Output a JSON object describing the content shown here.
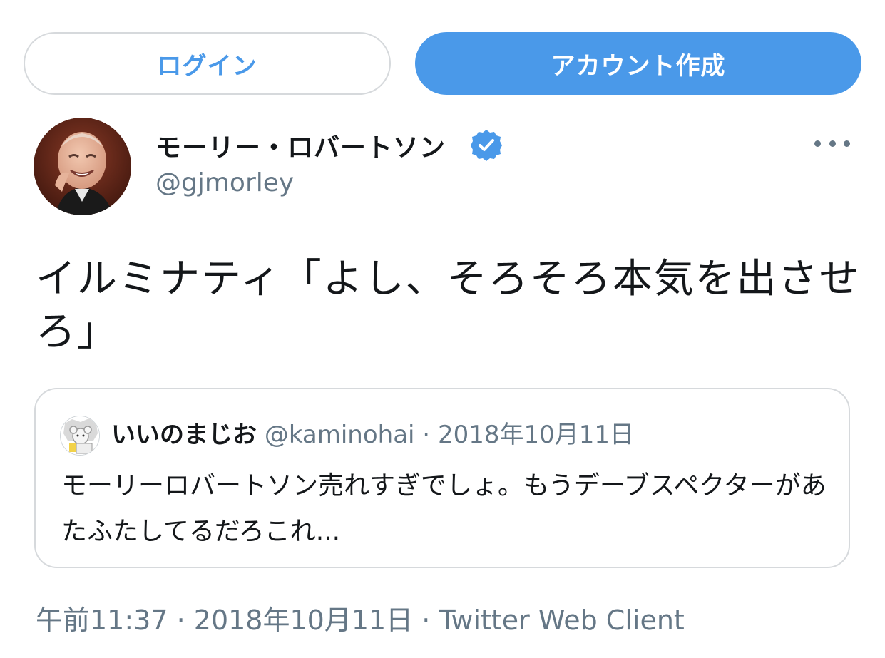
{
  "buttons": {
    "login_label": "ログイン",
    "signup_label": "アカウント作成"
  },
  "tweet": {
    "author_name": "モーリー・ロバートソン",
    "handle": "@gjmorley",
    "verified_icon": "verified-badge-icon",
    "more_icon": "more-options-icon",
    "text": "イルミナティ「よし、そろそろ本気を出させろ」",
    "time": "午前11:37",
    "date": "2018年10月11日",
    "source": "Twitter Web Client",
    "separator": " · "
  },
  "quoted_tweet": {
    "author_name": "いいのまじお",
    "handle": "@kaminohai",
    "separator": " · ",
    "date": "2018年10月11日",
    "text": "モーリーロバートソン売れすぎでしょ。もうデーブスペクターがあたふたしてるだろこれ..."
  },
  "colors": {
    "accent": "#4a99e9",
    "text_primary": "#14171a",
    "text_secondary": "#657786",
    "border": "#d6d9dc"
  }
}
